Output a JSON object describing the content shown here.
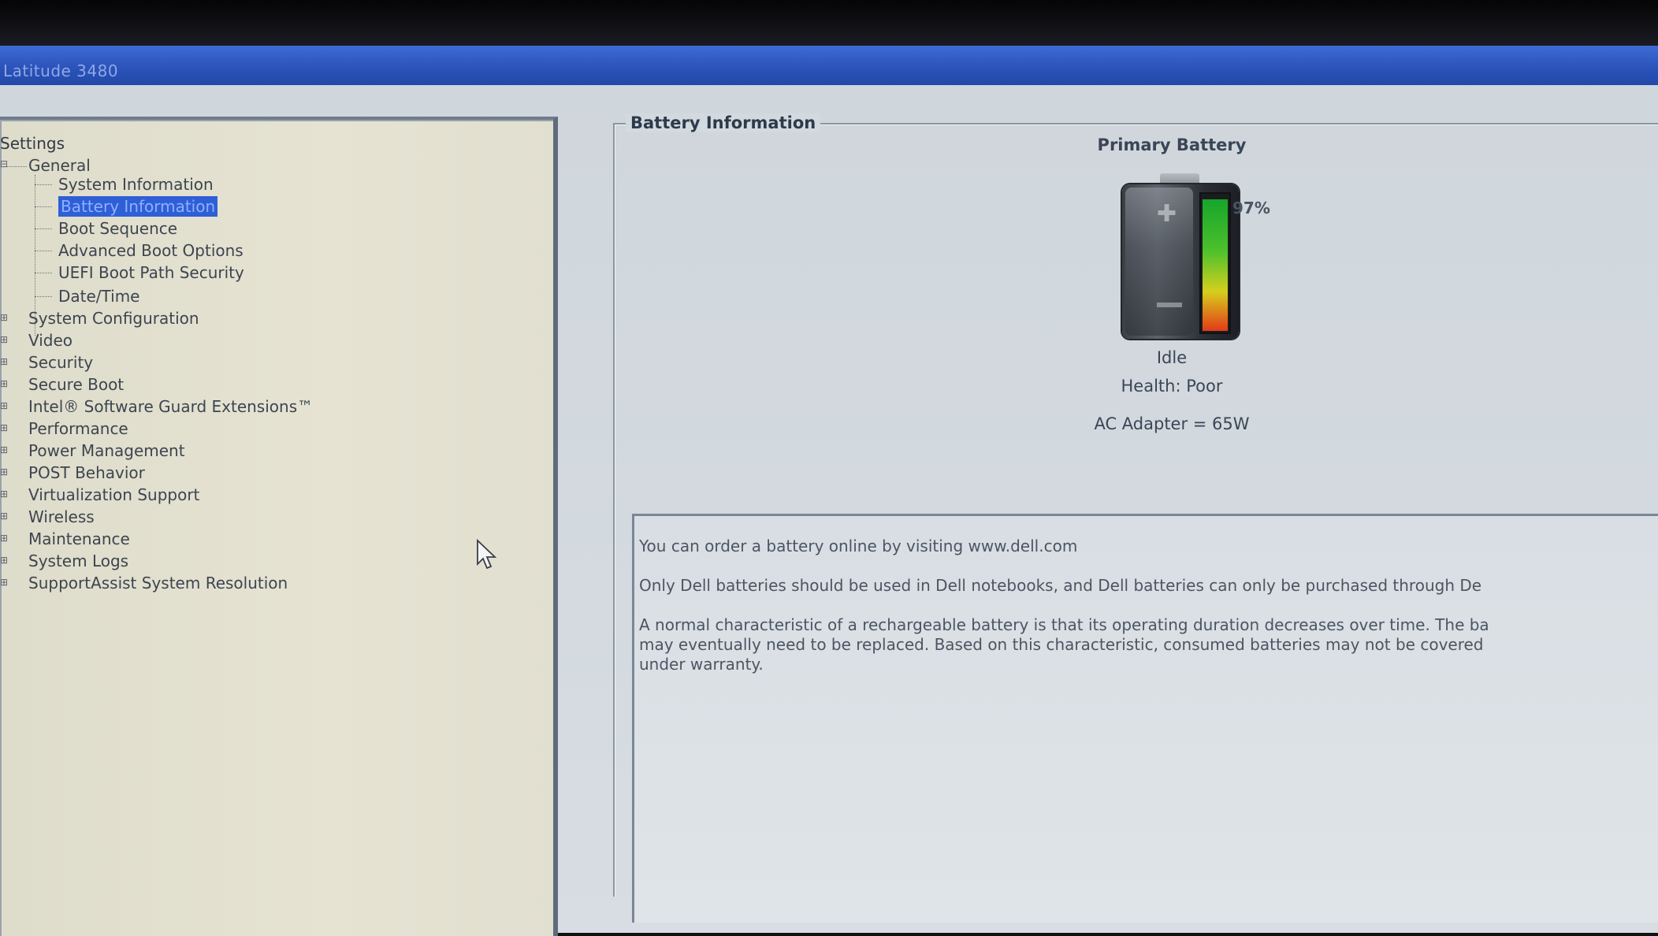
{
  "window": {
    "title": "Latitude 3480"
  },
  "tree": {
    "root_label": "Settings",
    "general": {
      "label": "General",
      "items": [
        {
          "label": "System Information",
          "selected": false
        },
        {
          "label": "Battery Information",
          "selected": true
        },
        {
          "label": "Boot Sequence",
          "selected": false
        },
        {
          "label": "Advanced Boot Options",
          "selected": false
        },
        {
          "label": "UEFI Boot Path Security",
          "selected": false
        },
        {
          "label": "Date/Time",
          "selected": false
        }
      ]
    },
    "categories": [
      {
        "label": "System Configuration"
      },
      {
        "label": "Video"
      },
      {
        "label": "Security"
      },
      {
        "label": "Secure Boot"
      },
      {
        "label": "Intel® Software Guard Extensions™"
      },
      {
        "label": "Performance"
      },
      {
        "label": "Power Management"
      },
      {
        "label": "POST Behavior"
      },
      {
        "label": "Virtualization Support"
      },
      {
        "label": "Wireless"
      },
      {
        "label": "Maintenance"
      },
      {
        "label": "System Logs"
      },
      {
        "label": "SupportAssist System Resolution"
      }
    ]
  },
  "battery_panel": {
    "group_title": "Battery Information",
    "battery_title": "Primary Battery",
    "charge_percent": 97,
    "charge_label": "97%",
    "state": "Idle",
    "health": "Health: Poor",
    "ac_adapter": "AC Adapter = 65W",
    "info_lines": [
      "You can order a battery online by visiting www.dell.com",
      "Only Dell batteries should be used in Dell notebooks, and Dell batteries can only be purchased through De",
      "A normal characteristic of a rechargeable battery is that its operating duration decreases over time.  The ba",
      "may eventually need to be replaced.  Based on this characteristic, consumed batteries may not be covered",
      "under warranty."
    ]
  },
  "icons": {
    "pointer": "mouse-pointer-icon",
    "battery": "battery-icon"
  }
}
